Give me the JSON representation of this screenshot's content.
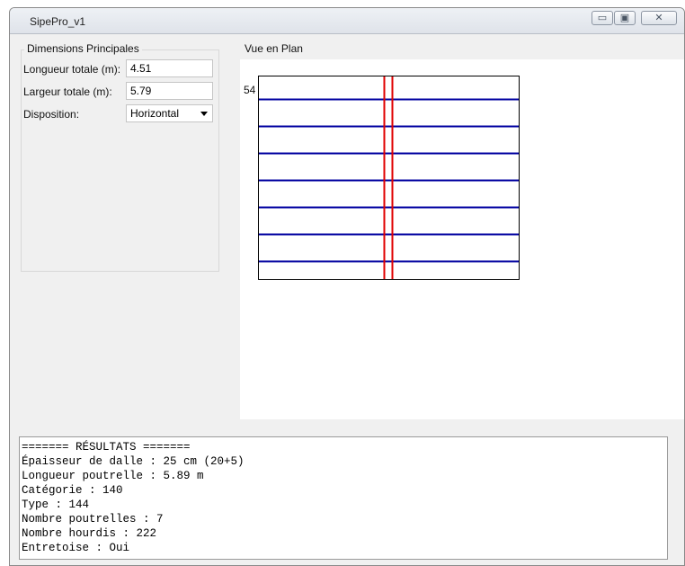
{
  "window": {
    "title": "SipePro_v1",
    "controls": {
      "minimize": "▭",
      "maximize": "▣",
      "close": "✕"
    }
  },
  "dimensions": {
    "group_title": "Dimensions Principales",
    "length_label": "Longueur totale (m):",
    "length_value": "4.51",
    "width_label": "Largeur totale (m):",
    "width_value": "5.79",
    "layout_label": "Disposition:",
    "layout_value": "Horizontal"
  },
  "plan": {
    "group_title": "Vue en Plan",
    "side_number": "54",
    "colors": {
      "beam": "#0000a0",
      "tie": "#e00000",
      "border": "#000000"
    }
  },
  "results": {
    "lines": [
      "======= RÉSULTATS =======",
      "Épaisseur de dalle : 25 cm (20+5)",
      "Longueur poutrelle : 5.89 m",
      "Catégorie : 140",
      "Type : 144",
      "Nombre poutrelles : 7",
      "Nombre hourdis : 222",
      "Entretoise : Oui"
    ]
  }
}
